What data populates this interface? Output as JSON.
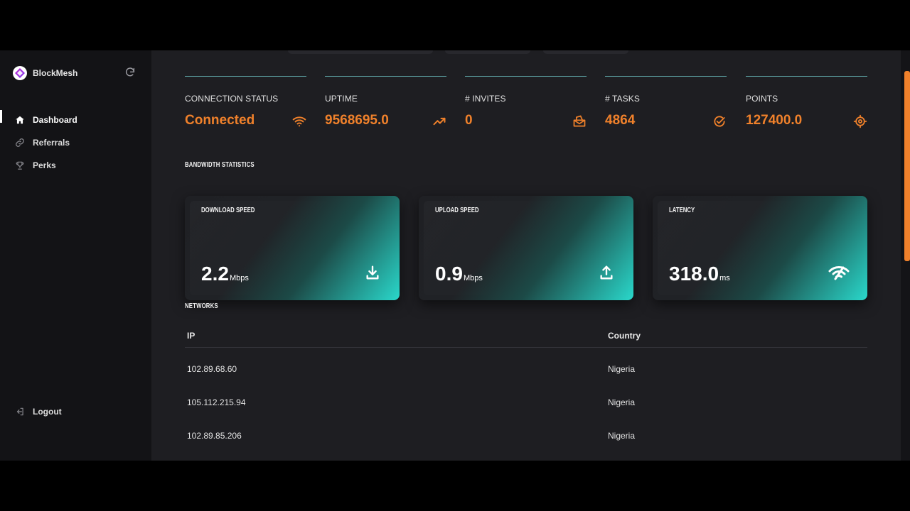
{
  "app": {
    "name": "BlockMesh"
  },
  "sidebar": {
    "items": [
      {
        "label": "Dashboard",
        "icon": "home-icon",
        "active": true
      },
      {
        "label": "Referrals",
        "icon": "link-icon",
        "active": false
      },
      {
        "label": "Perks",
        "icon": "trophy-icon",
        "active": false
      }
    ],
    "logout_label": "Logout",
    "refresh_icon": "refresh-icon"
  },
  "stats": [
    {
      "label": "CONNECTION STATUS",
      "value": "Connected",
      "icon": "wifi-icon"
    },
    {
      "label": "UPTIME",
      "value": "9568695.0",
      "icon": "trending-up-icon"
    },
    {
      "label": "# INVITES",
      "value": "0",
      "icon": "invites-icon"
    },
    {
      "label": "# TASKS",
      "value": "4864",
      "icon": "check-circle-icon"
    },
    {
      "label": "POINTS",
      "value": "127400.0",
      "icon": "target-icon"
    }
  ],
  "bandwidth": {
    "title": "BANDWIDTH STATISTICS",
    "cards": [
      {
        "title": "DOWNLOAD SPEED",
        "value": "2.2",
        "unit": "Mbps",
        "icon": "download-icon"
      },
      {
        "title": "UPLOAD SPEED",
        "value": "0.9",
        "unit": "Mbps",
        "icon": "upload-icon"
      },
      {
        "title": "LATENCY",
        "value": "318.0",
        "unit": "ms",
        "icon": "signal-icon"
      }
    ]
  },
  "networks": {
    "title": "NETWORKS",
    "columns": [
      "IP",
      "Country"
    ],
    "rows": [
      {
        "ip": "102.89.68.60",
        "country": "Nigeria"
      },
      {
        "ip": "105.112.215.94",
        "country": "Nigeria"
      },
      {
        "ip": "102.89.85.206",
        "country": "Nigeria"
      }
    ]
  },
  "colors": {
    "accent": "#f0812b",
    "teal": "#2ad8cb",
    "background": "#1e1e22",
    "sidebar": "#131316"
  }
}
